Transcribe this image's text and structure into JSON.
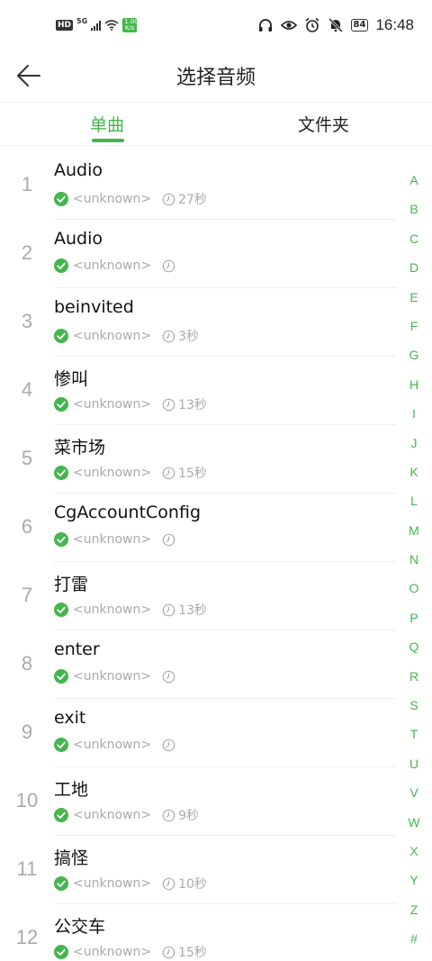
{
  "status_bar": {
    "hd": "HD",
    "network": "5G",
    "data": "1.00 K/s",
    "battery": "84",
    "time": "16:48"
  },
  "header": {
    "title": "选择音频"
  },
  "tabs": [
    {
      "label": "单曲",
      "active": true
    },
    {
      "label": "文件夹",
      "active": false
    }
  ],
  "accent_color": "#44b64c",
  "list": [
    {
      "num": "1",
      "title": "Audio",
      "artist": "<unknown>",
      "duration": "27秒"
    },
    {
      "num": "2",
      "title": "Audio",
      "artist": "<unknown>",
      "duration": ""
    },
    {
      "num": "3",
      "title": "beinvited",
      "artist": "<unknown>",
      "duration": "3秒"
    },
    {
      "num": "4",
      "title": "惨叫",
      "artist": "<unknown>",
      "duration": "13秒"
    },
    {
      "num": "5",
      "title": "菜市场",
      "artist": "<unknown>",
      "duration": "15秒"
    },
    {
      "num": "6",
      "title": "CgAccountConfig",
      "artist": "<unknown>",
      "duration": ""
    },
    {
      "num": "7",
      "title": "打雷",
      "artist": "<unknown>",
      "duration": "13秒"
    },
    {
      "num": "8",
      "title": "enter",
      "artist": "<unknown>",
      "duration": ""
    },
    {
      "num": "9",
      "title": "exit",
      "artist": "<unknown>",
      "duration": ""
    },
    {
      "num": "10",
      "title": "工地",
      "artist": "<unknown>",
      "duration": "9秒"
    },
    {
      "num": "11",
      "title": "搞怪",
      "artist": "<unknown>",
      "duration": "10秒"
    },
    {
      "num": "12",
      "title": "公交车",
      "artist": "<unknown>",
      "duration": "15秒"
    }
  ],
  "alphabet": [
    "A",
    "B",
    "C",
    "D",
    "E",
    "F",
    "G",
    "H",
    "I",
    "J",
    "K",
    "L",
    "M",
    "N",
    "O",
    "P",
    "Q",
    "R",
    "S",
    "T",
    "U",
    "V",
    "W",
    "X",
    "Y",
    "Z",
    "#"
  ]
}
